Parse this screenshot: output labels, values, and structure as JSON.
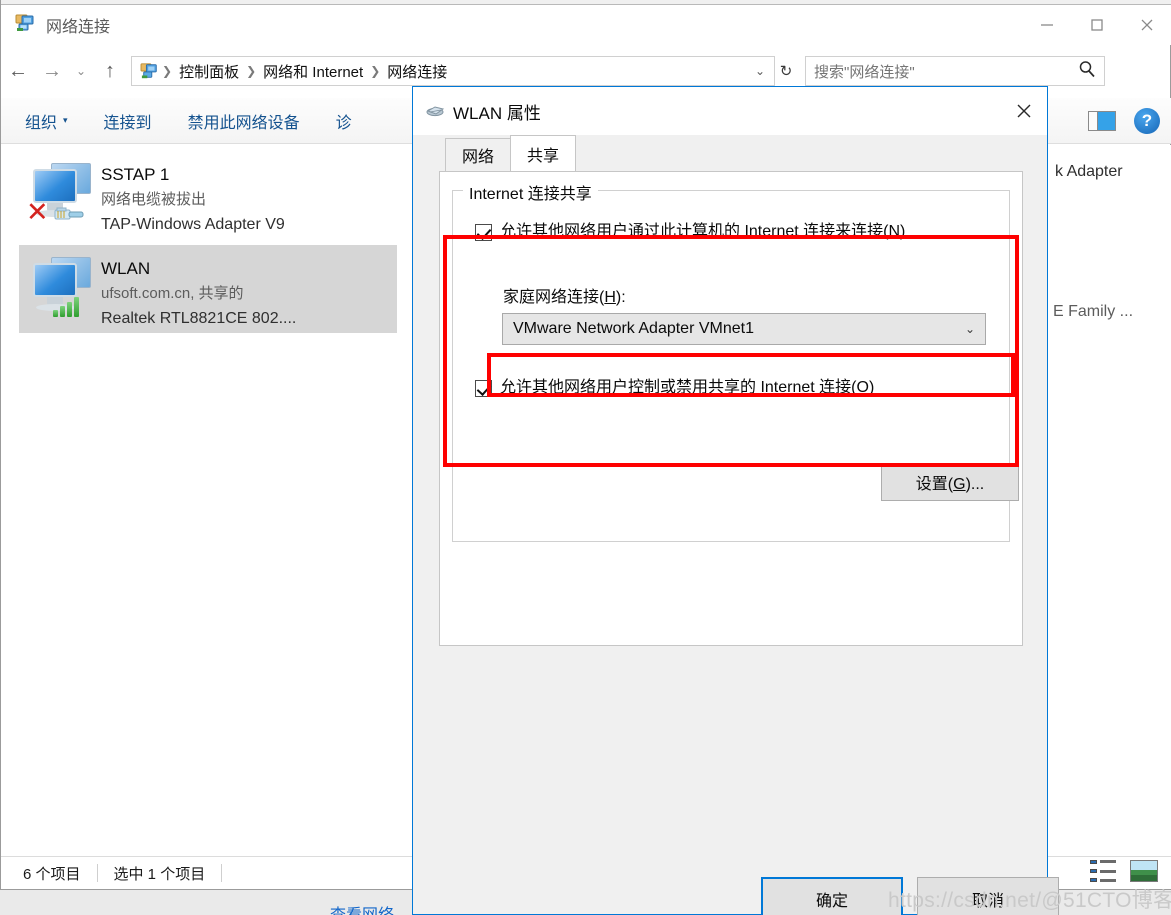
{
  "window": {
    "title": "网络连接",
    "icon": "network-connections-icon",
    "minimize_label": "—",
    "maximize_label": "☐",
    "close_label": "✕"
  },
  "address_bar": {
    "back_label": "←",
    "forward_label": "→",
    "recent_label": "⌄",
    "up_label": "↑",
    "crumbs": [
      "控制面板",
      "网络和 Internet",
      "网络连接"
    ],
    "separator": "❯",
    "dropdown_label": "⌄",
    "refresh_label": "↻"
  },
  "search": {
    "placeholder": "搜索\"网络连接\"",
    "icon": "search-icon"
  },
  "toolbar": {
    "items": [
      {
        "label": "组织",
        "has_caret": true
      },
      {
        "label": "连接到",
        "has_caret": false
      },
      {
        "label": "禁用此网络设备",
        "has_caret": false
      },
      {
        "label": "诊",
        "has_caret": false
      }
    ],
    "preview_pane_icon": "preview-pane-icon",
    "help_label": "?"
  },
  "connections": [
    {
      "name": "SSTAP 1",
      "status": "网络电缆被拔出",
      "device": "TAP-Windows Adapter V9",
      "selected": false,
      "state_icon": "red-x-icon",
      "media_icon": "ethernet-cable-icon"
    },
    {
      "name": "WLAN",
      "status": "ufsoft.com.cn, 共享的",
      "device": "Realtek RTL8821CE 802....",
      "selected": true,
      "state_icon": "none",
      "media_icon": "wifi-signal-icon"
    }
  ],
  "occluded_items": [
    {
      "text": "k Adapter",
      "color": "#2f2f2f"
    },
    {
      "text": "E Family ...",
      "color": "#5c5c5c"
    }
  ],
  "status_bar": {
    "item_count": "6 个项目",
    "selection": "选中 1 个项目",
    "details_view_icon": "details-view-icon",
    "large_icons_view_icon": "large-icons-view-icon"
  },
  "bottom_cut_text": "查看网络",
  "dialog": {
    "title": "WLAN 属性",
    "icon": "network-adapter-icon",
    "close_label": "✕",
    "tabs": [
      {
        "label": "网络",
        "active": false
      },
      {
        "label": "共享",
        "active": true
      }
    ],
    "group_title": "Internet 连接共享",
    "checkbox_share": {
      "checked": true,
      "text_before": "允许其他网络用户通过此计算机的 Internet 连接来连接(",
      "accel": "N",
      "text_after": ")"
    },
    "home_network_label": {
      "text_before": "家庭网络连接(",
      "accel": "H",
      "text_after": "):"
    },
    "home_network_value": "VMware Network Adapter VMnet1",
    "combo_caret": "⌄",
    "checkbox_control": {
      "checked": true,
      "text_before": "允许其他网络用户控制或禁用共享的 Internet 连接(",
      "accel": "O",
      "text_after": ")"
    },
    "settings_button": {
      "text_before": "设置(",
      "accel": "G",
      "text_after": ")..."
    },
    "ok_button": "确定",
    "cancel_button": "取消"
  },
  "annotations": {
    "highlight_color": "#fe0000",
    "boxes": [
      {
        "name": "ics-section-highlight"
      },
      {
        "name": "home-network-combo-highlight"
      }
    ]
  },
  "watermark": "https://csdn.net/@51CTO博客"
}
